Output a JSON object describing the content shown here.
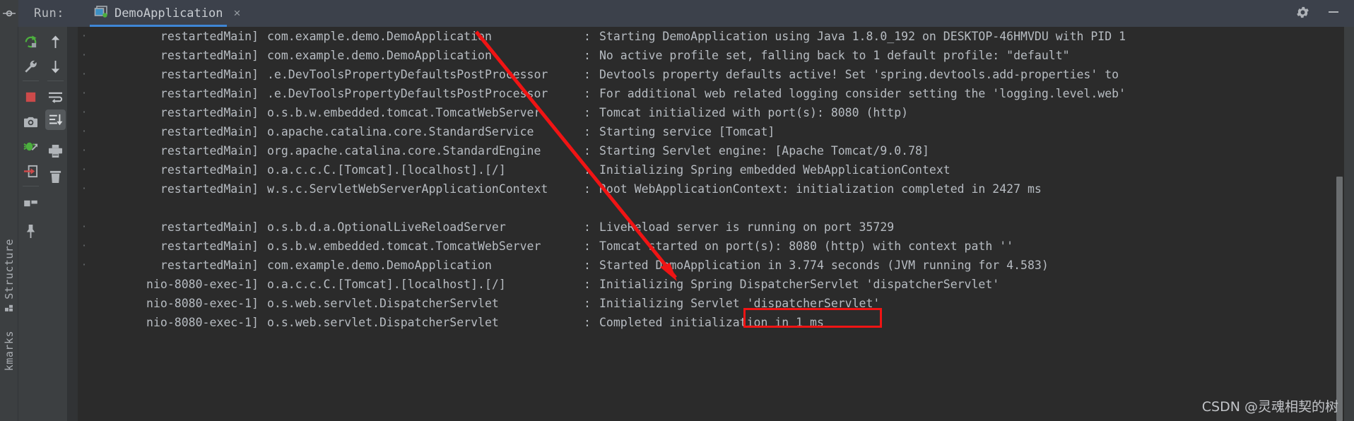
{
  "window": {
    "run_label": "Run:",
    "tab": {
      "label": "DemoApplication",
      "icon": "run-configuration-icon",
      "close": "×"
    },
    "settings_icon": "gear-icon",
    "minimize_icon": "minimize-icon",
    "accent": "#3e86d6"
  },
  "left_rail": {
    "items": [
      {
        "label": "Structure",
        "icon": "structure-icon"
      },
      {
        "label": "kmarks",
        "icon": "bookmarks-icon"
      }
    ]
  },
  "toolbar_primary": {
    "buttons": [
      {
        "name": "rerun-button",
        "icon": "rerun-green-arrow-icon"
      },
      {
        "name": "edit-configuration-button",
        "icon": "wrench-icon"
      },
      {
        "name": "stop-button",
        "icon": "stop-red-square-icon"
      },
      {
        "name": "screenshot-button",
        "icon": "camera-icon"
      },
      {
        "name": "attach-debugger-button",
        "icon": "green-bug-icon"
      },
      {
        "name": "export-button",
        "icon": "red-arrow-into-box-icon"
      },
      {
        "name": "layout-button",
        "icon": "layout-squares-icon"
      },
      {
        "name": "pin-tab-button",
        "icon": "pin-icon"
      }
    ]
  },
  "toolbar_secondary": {
    "buttons": [
      {
        "name": "scroll-up-button",
        "icon": "arrow-up-icon"
      },
      {
        "name": "scroll-down-button",
        "icon": "arrow-down-icon"
      },
      {
        "name": "soft-wrap-button",
        "icon": "soft-wrap-icon"
      },
      {
        "name": "scroll-to-end-button",
        "icon": "scroll-to-end-icon",
        "active": true
      },
      {
        "name": "print-button",
        "icon": "printer-icon"
      },
      {
        "name": "clear-all-button",
        "icon": "trash-icon"
      }
    ]
  },
  "console": {
    "background": "#2b2b2b",
    "text_color": "#b7bcc2",
    "lines": [
      {
        "fold": "·",
        "thread": "restartedMain]",
        "logger": "com.example.demo.DemoApplication",
        "colon": ":",
        "message": "Starting DemoApplication using Java 1.8.0_192 on DESKTOP-46HMVDU with PID 1"
      },
      {
        "fold": "·",
        "thread": "restartedMain]",
        "logger": "com.example.demo.DemoApplication",
        "colon": ":",
        "message": "No active profile set, falling back to 1 default profile: \"default\""
      },
      {
        "fold": "·",
        "thread": "restartedMain]",
        "logger": ".e.DevToolsPropertyDefaultsPostProcessor",
        "colon": ":",
        "message": "Devtools property defaults active! Set 'spring.devtools.add-properties' to"
      },
      {
        "fold": "·",
        "thread": "restartedMain]",
        "logger": ".e.DevToolsPropertyDefaultsPostProcessor",
        "colon": ":",
        "message": "For additional web related logging consider setting the 'logging.level.web'"
      },
      {
        "fold": "·",
        "thread": "restartedMain]",
        "logger": "o.s.b.w.embedded.tomcat.TomcatWebServer",
        "colon": ":",
        "message": "Tomcat initialized with port(s): 8080 (http)"
      },
      {
        "fold": "·",
        "thread": "restartedMain]",
        "logger": "o.apache.catalina.core.StandardService",
        "colon": ":",
        "message": "Starting service [Tomcat]"
      },
      {
        "fold": "·",
        "thread": "restartedMain]",
        "logger": "org.apache.catalina.core.StandardEngine",
        "colon": ":",
        "message": "Starting Servlet engine: [Apache Tomcat/9.0.78]"
      },
      {
        "fold": "·",
        "thread": "restartedMain]",
        "logger": "o.a.c.c.C.[Tomcat].[localhost].[/]",
        "colon": ":",
        "message": "Initializing Spring embedded WebApplicationContext"
      },
      {
        "fold": "·",
        "thread": "restartedMain]",
        "logger": "w.s.c.ServletWebServerApplicationContext",
        "colon": ":",
        "message": "Root WebApplicationContext: initialization completed in 2427 ms"
      },
      {
        "blank": true
      },
      {
        "fold": "·",
        "thread": "restartedMain]",
        "logger": "o.s.b.d.a.OptionalLiveReloadServer",
        "colon": ":",
        "message": "LiveReload server is running on port 35729"
      },
      {
        "fold": "·",
        "thread": "restartedMain]",
        "logger": "o.s.b.w.embedded.tomcat.TomcatWebServer",
        "colon": ":",
        "message": "Tomcat started on port(s): 8080 (http) with context path ''"
      },
      {
        "fold": "·",
        "thread": "restartedMain]",
        "logger": "com.example.demo.DemoApplication",
        "colon": ":",
        "message": "Started DemoApplication in 3.774 seconds (JVM running for 4.583)"
      },
      {
        "fold": "",
        "thread": "nio-8080-exec-1]",
        "logger": "o.a.c.c.C.[Tomcat].[localhost].[/]",
        "colon": ":",
        "message": "Initializing Spring DispatcherServlet 'dispatcherServlet'"
      },
      {
        "fold": "",
        "thread": "nio-8080-exec-1]",
        "logger": "o.s.web.servlet.DispatcherServlet",
        "colon": ":",
        "message": "Initializing Servlet 'dispatcherServlet'"
      },
      {
        "fold": "",
        "thread": "nio-8080-exec-1]",
        "logger": "o.s.web.servlet.DispatcherServlet",
        "colon": ":",
        "message": "Completed initialization in 1 ms"
      }
    ]
  },
  "annotations": {
    "arrow_color": "#f01414",
    "highlight_box_color": "#f01414",
    "highlight_target": "DispatcherServlet"
  },
  "watermark": {
    "text": "CSDN @灵魂相契的树"
  }
}
